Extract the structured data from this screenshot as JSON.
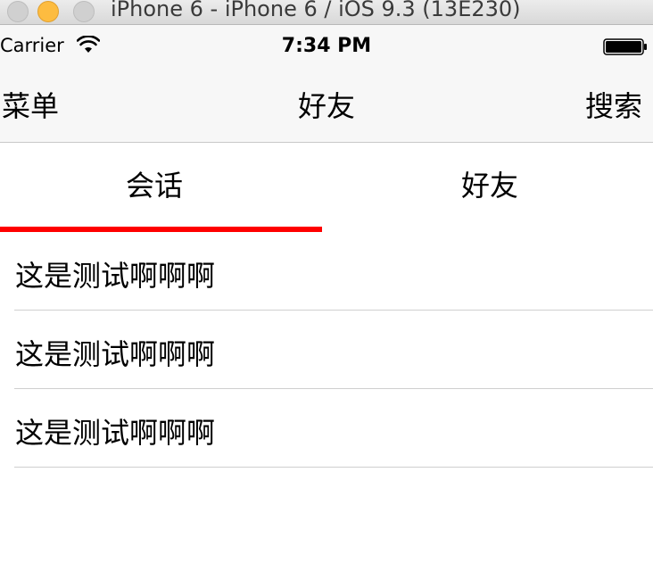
{
  "window": {
    "title": "iPhone 6 - iPhone 6 / iOS 9.3 (13E230)"
  },
  "status_bar": {
    "carrier": "Carrier",
    "time": "7:34 PM",
    "wifi_icon": "wifi-icon",
    "battery_icon": "battery-icon"
  },
  "nav_bar": {
    "left_label": "菜单",
    "title": "好友",
    "right_label": "搜索"
  },
  "segments": {
    "tabs": [
      {
        "label": "会话"
      },
      {
        "label": "好友"
      }
    ],
    "selected_index": 0,
    "indicator_color": "#ff0000"
  },
  "list": {
    "items": [
      {
        "label": "这是测试啊啊啊"
      },
      {
        "label": "这是测试啊啊啊"
      },
      {
        "label": "这是测试啊啊啊"
      }
    ]
  }
}
